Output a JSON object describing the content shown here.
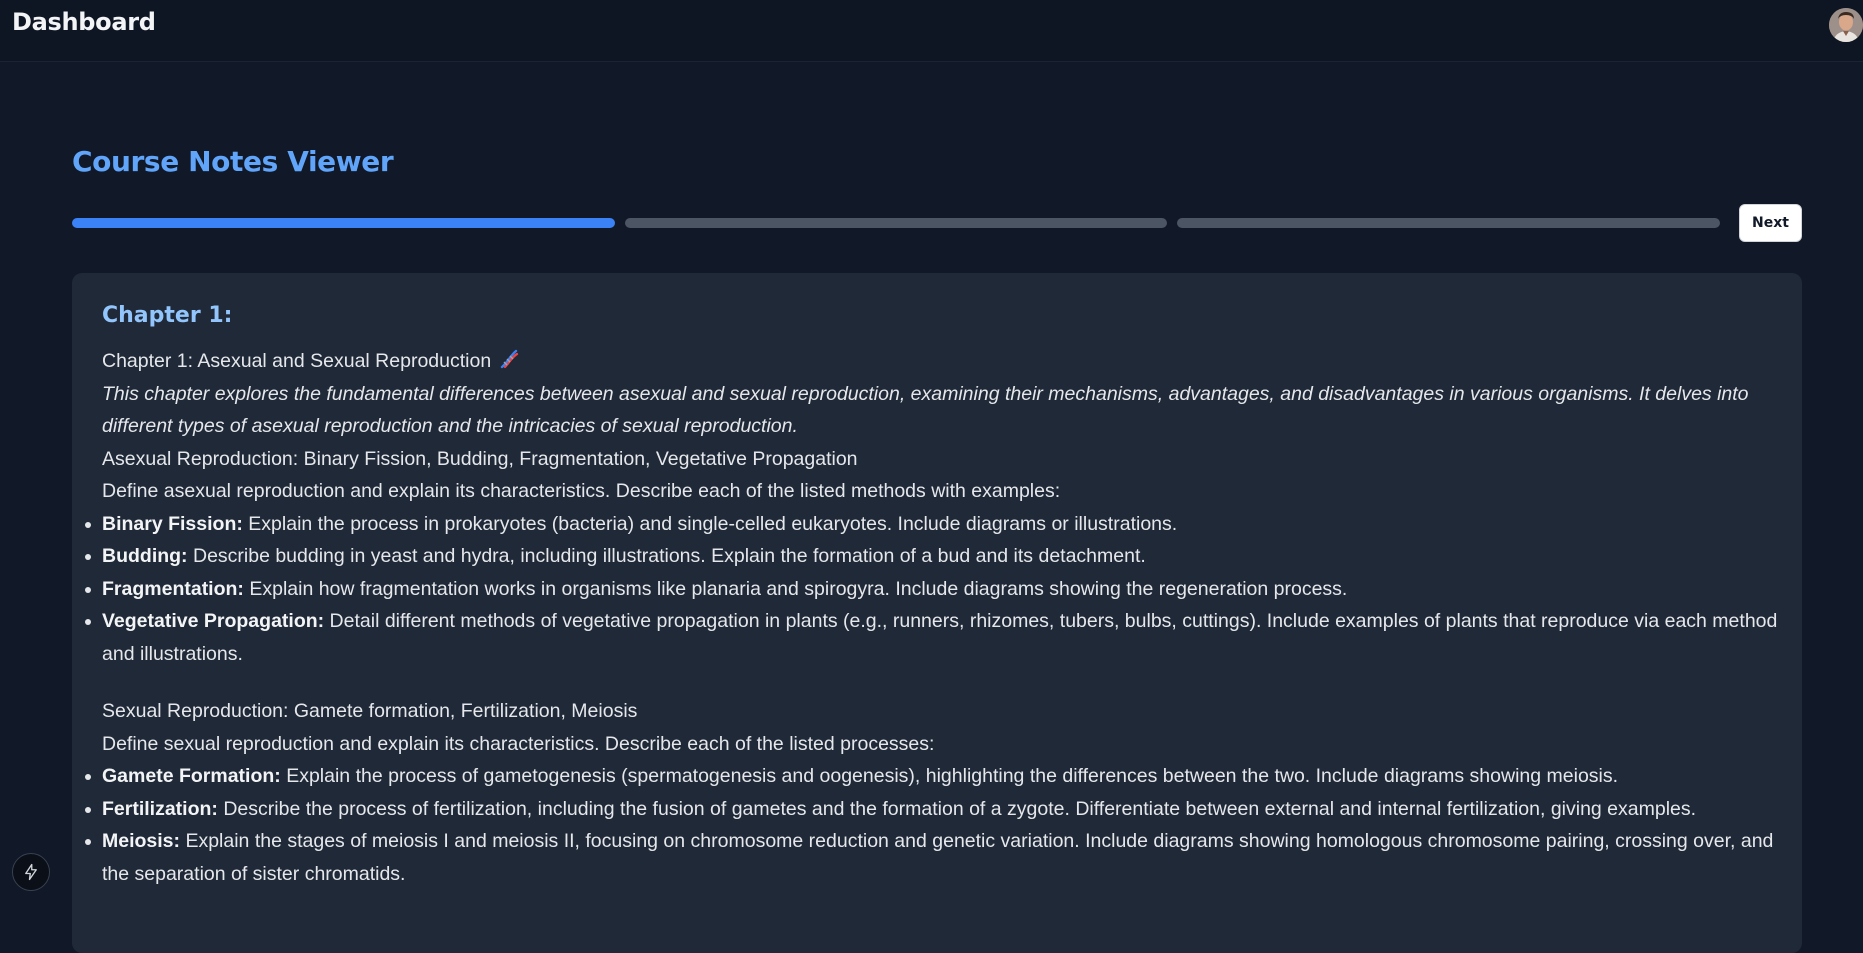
{
  "topbar": {
    "title": "Dashboard",
    "avatar_icon": "user-avatar"
  },
  "page": {
    "title": "Course Notes Viewer"
  },
  "progress": {
    "segments": 3,
    "current": 1,
    "active_color": "#3b82f6",
    "inactive_color": "#4b5563"
  },
  "nav": {
    "next_label": "Next"
  },
  "chapter": {
    "heading": "Chapter 1:",
    "title": "Chapter 1: Asexual and Sexual Reproduction",
    "title_icon": "dna-icon",
    "summary": "This chapter explores the fundamental differences between asexual and sexual reproduction, examining their mechanisms, advantages, and disadvantages in various organisms. It delves into different types of asexual reproduction and the intricacies of sexual reproduction.",
    "sections": [
      {
        "title": "Asexual Reproduction: Binary Fission, Budding, Fragmentation, Vegetative Propagation",
        "intro": "Define asexual reproduction and explain its characteristics. Describe each of the listed methods with examples:",
        "items": [
          {
            "term": "Binary Fission:",
            "text": " Explain the process in prokaryotes (bacteria) and single-celled eukaryotes. Include diagrams or illustrations."
          },
          {
            "term": "Budding:",
            "text": " Describe budding in yeast and hydra, including illustrations. Explain the formation of a bud and its detachment."
          },
          {
            "term": "Fragmentation:",
            "text": " Explain how fragmentation works in organisms like planaria and spirogyra. Include diagrams showing the regeneration process."
          },
          {
            "term": "Vegetative Propagation:",
            "text": " Detail different methods of vegetative propagation in plants (e.g., runners, rhizomes, tubers, bulbs, cuttings). Include examples of plants that reproduce via each method and illustrations."
          }
        ]
      },
      {
        "title": "Sexual Reproduction: Gamete formation, Fertilization, Meiosis",
        "intro": "Define sexual reproduction and explain its characteristics. Describe each of the listed processes:",
        "items": [
          {
            "term": "Gamete Formation:",
            "text": " Explain the process of gametogenesis (spermatogenesis and oogenesis), highlighting the differences between the two. Include diagrams showing meiosis."
          },
          {
            "term": "Fertilization:",
            "text": " Describe the process of fertilization, including the fusion of gametes and the formation of a zygote. Differentiate between external and internal fertilization, giving examples."
          },
          {
            "term": "Meiosis:",
            "text": " Explain the stages of meiosis I and meiosis II, focusing on chromosome reduction and genetic variation. Include diagrams showing homologous chromosome pairing, crossing over, and the separation of sister chromatids."
          }
        ]
      }
    ]
  },
  "floating": {
    "icon": "bolt-icon"
  }
}
